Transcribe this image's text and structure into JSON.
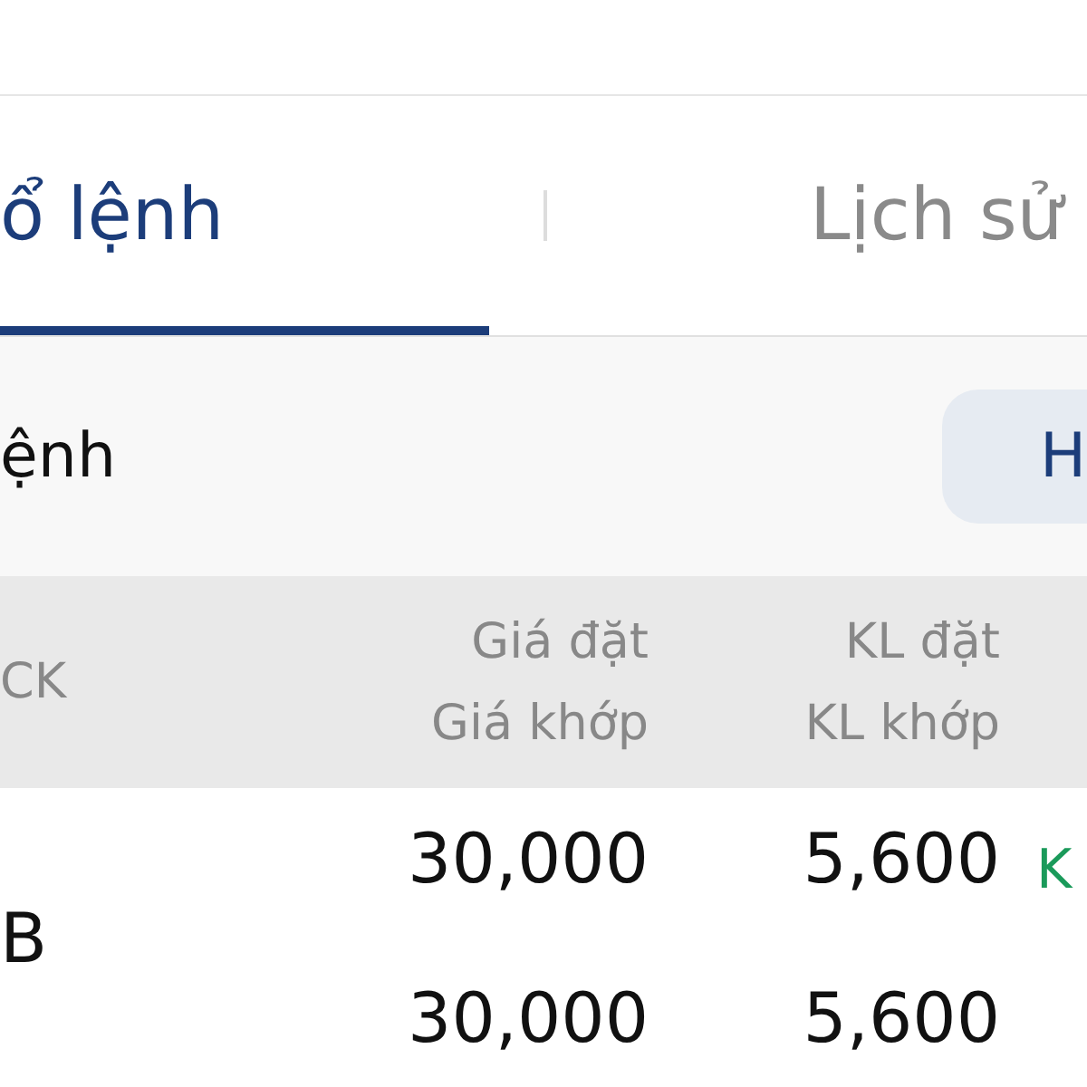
{
  "tabs": [
    {
      "label": "ổ lệnh",
      "selected": true
    },
    {
      "label": "Lịch sử",
      "selected": false
    }
  ],
  "toolbar": {
    "title": "ệnh",
    "button": "H"
  },
  "table": {
    "columns": [
      {
        "lines": [
          "CK"
        ]
      },
      {
        "lines": [
          "Giá đặt",
          "Giá khớp"
        ]
      },
      {
        "lines": [
          "KL đặt",
          "KL khớp"
        ]
      }
    ],
    "rows": [
      {
        "symbol": "B",
        "order_price": "30,000",
        "match_price": "30,000",
        "order_qty": "5,600",
        "match_qty": "5,600",
        "status": "K"
      }
    ]
  }
}
